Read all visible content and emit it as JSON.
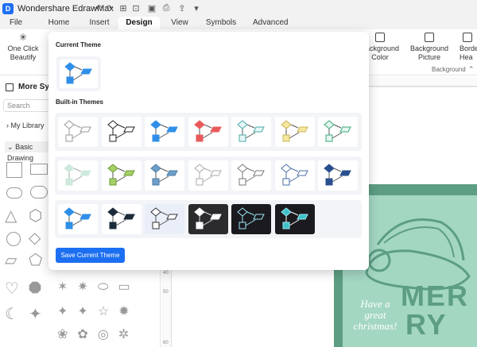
{
  "app": {
    "title": "Wondershare EdrawMax",
    "logo_letter": "D"
  },
  "menu": [
    {
      "label": "File"
    },
    {
      "label": "Home"
    },
    {
      "label": "Insert"
    },
    {
      "label": "Design",
      "active": true
    },
    {
      "label": "View"
    },
    {
      "label": "Symbols"
    },
    {
      "label": "Advanced"
    }
  ],
  "toolbar": {
    "beautify_label_1": "One Click",
    "beautify_label_2": "Beautify",
    "bg_color_label_1": "Background",
    "bg_color_label_2": "Color",
    "bg_picture_label_1": "Background",
    "bg_picture_label_2": "Picture",
    "border_label_1": "Borde",
    "border_label_2": "Hea",
    "group_label": "Background",
    "chevron": "⌃"
  },
  "sidebar": {
    "title": "More Sym",
    "search_placeholder": "Search",
    "my_library": "My Library",
    "basic_drawing": "Basic Drawing"
  },
  "ruler": {
    "left_numbers": [
      "40",
      "50",
      "60"
    ]
  },
  "canvas_card": {
    "line1": "Have a",
    "line2": "great",
    "line3": "christmas!",
    "merry_1": "MER",
    "merry_2": "RY",
    "colors": {
      "outer": "#5d9e83",
      "inner": "#a3d7c2"
    }
  },
  "theme_panel": {
    "current_theme_label": "Current Theme",
    "built_in_label": "Built-in Themes",
    "save_button": "Save Current Theme",
    "current": {
      "diamond": "#2f8fe8",
      "square": "#2f8fe8",
      "para": "#2f8fe8",
      "line": "#555",
      "bg": "#ffffff"
    },
    "rows": [
      [
        {
          "diamond": "#ffffff",
          "square": "#ffffff",
          "para": "#ffffff",
          "line": "#999999",
          "bg": "#ffffff",
          "stroke": "#999999"
        },
        {
          "diamond": "#ffffff",
          "square": "#ffffff",
          "para": "#ffffff",
          "line": "#222222",
          "bg": "#ffffff",
          "stroke": "#222222"
        },
        {
          "diamond": "#2f8fe8",
          "square": "#2f8fe8",
          "para": "#2f8fe8",
          "line": "#555555",
          "bg": "#ffffff",
          "stroke": "#2f8fe8"
        },
        {
          "diamond": "#e85a5a",
          "square": "#e85a5a",
          "para": "#e85a5a",
          "line": "#555555",
          "bg": "#ffffff",
          "stroke": "#e85a5a"
        },
        {
          "diamond": "#e6f6f6",
          "square": "#e6f6f6",
          "para": "#e6f6f6",
          "line": "#555555",
          "bg": "#ffffff",
          "stroke": "#4aa8a8"
        },
        {
          "diamond": "#f5e79e",
          "square": "#f5e79e",
          "para": "#f5e79e",
          "line": "#555555",
          "bg": "#ffffff",
          "stroke": "#c8b45a"
        },
        {
          "diamond": "#e4f6ee",
          "square": "#e4f6ee",
          "para": "#e4f6ee",
          "line": "#555555",
          "bg": "#ffffff",
          "stroke": "#3aaa7a"
        }
      ],
      [
        {
          "diamond": "#cfe9dd",
          "square": "#cfe9dd",
          "para": "#cfe9dd",
          "line": "#aaaaaa",
          "bg": "#ffffff",
          "stroke": "#cfe9dd"
        },
        {
          "diamond": "#a6cf6a",
          "square": "#a6cf6a",
          "para": "#a6cf6a",
          "line": "#555555",
          "bg": "#ffffff",
          "stroke": "#6c9a33"
        },
        {
          "diamond": "#6e9fc9",
          "square": "#6e9fc9",
          "para": "#6e9fc9",
          "line": "#555555",
          "bg": "#ffffff",
          "stroke": "#4a7aa6"
        },
        {
          "diamond": "#ffffff",
          "square": "#ffffff",
          "para": "#ffffff",
          "line": "#aaaaaa",
          "bg": "#ffffff",
          "stroke": "#aaaaaa"
        },
        {
          "diamond": "#ffffff",
          "square": "#ffffff",
          "para": "#ffffff",
          "line": "#777777",
          "bg": "#ffffff",
          "stroke": "#777777"
        },
        {
          "diamond": "#ffffff",
          "square": "#ffffff",
          "para": "#ffffff",
          "line": "#4a6fa5",
          "bg": "#ffffff",
          "stroke": "#4a6fa5"
        },
        {
          "diamond": "#2a4f8f",
          "square": "#2a4f8f",
          "para": "#2a4f8f",
          "line": "#555555",
          "bg": "#ffffff",
          "stroke": "#2a4f8f"
        }
      ],
      [
        {
          "diamond": "#2f8fe8",
          "square": "#2f8fe8",
          "para": "#2f8fe8",
          "line": "#555555",
          "bg": "#ffffff",
          "stroke": "#2f8fe8"
        },
        {
          "diamond": "#1c2b3a",
          "square": "#1c2b3a",
          "para": "#1c2b3a",
          "line": "#555555",
          "bg": "#ffffff",
          "stroke": "#1c2b3a"
        },
        {
          "diamond": "#ffffff",
          "square": "#ffffff",
          "para": "#ffffff",
          "line": "#555555",
          "bg": "#e9eef8",
          "stroke": "#333333"
        },
        {
          "diamond": "#ffffff",
          "square": "#ffffff",
          "para": "#ffffff",
          "line": "#dddddd",
          "bg": "#2b2b2e",
          "stroke": "#ffffff"
        },
        {
          "diamond": "#1a1a1f",
          "square": "#1a1a1f",
          "para": "#1a1a1f",
          "line": "#9ee6f0",
          "bg": "#1a1a1f",
          "stroke": "#9ee6f0"
        },
        {
          "diamond": "#3fc1c9",
          "square": "#3fc1c9",
          "para": "#3fc1c9",
          "line": "#ffffff",
          "bg": "#1a1a1f",
          "stroke": "#9ee6f0"
        }
      ]
    ]
  }
}
